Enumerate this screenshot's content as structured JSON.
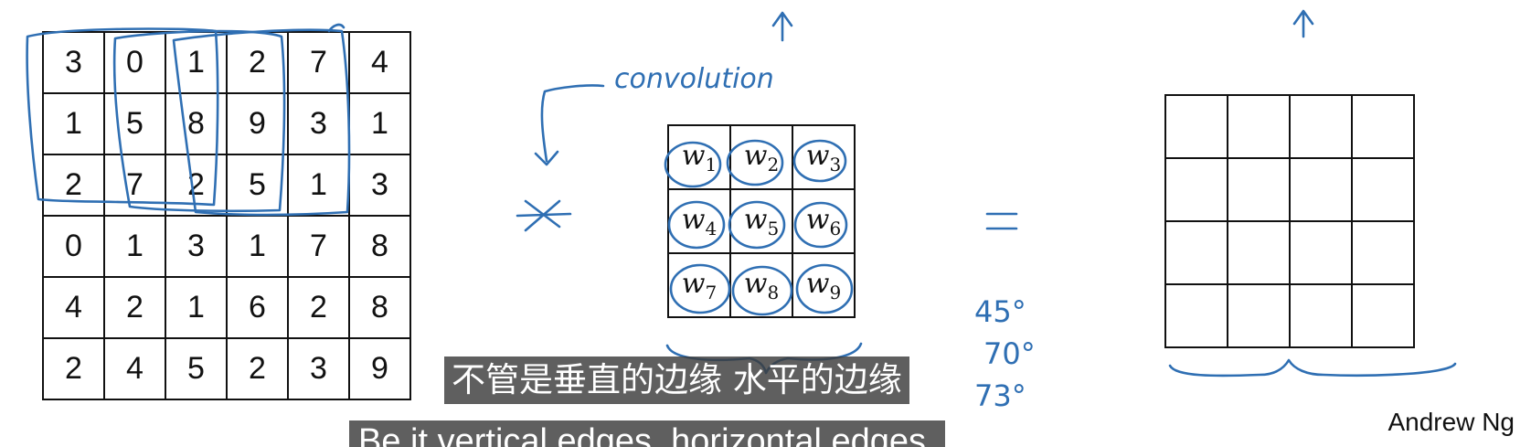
{
  "input_matrix": [
    [
      "3",
      "0",
      "1",
      "2",
      "7",
      "4"
    ],
    [
      "1",
      "5",
      "8",
      "9",
      "3",
      "1"
    ],
    [
      "2",
      "7",
      "2",
      "5",
      "1",
      "3"
    ],
    [
      "0",
      "1",
      "3",
      "1",
      "7",
      "8"
    ],
    [
      "4",
      "2",
      "1",
      "6",
      "2",
      "8"
    ],
    [
      "2",
      "4",
      "5",
      "2",
      "3",
      "9"
    ]
  ],
  "filter": [
    [
      {
        "w": "w",
        "sub": "1"
      },
      {
        "w": "w",
        "sub": "2"
      },
      {
        "w": "w",
        "sub": "3"
      }
    ],
    [
      {
        "w": "w",
        "sub": "4"
      },
      {
        "w": "w",
        "sub": "5"
      },
      {
        "w": "w",
        "sub": "6"
      }
    ],
    [
      {
        "w": "w",
        "sub": "7"
      },
      {
        "w": "w",
        "sub": "8"
      },
      {
        "w": "w",
        "sub": "9"
      }
    ]
  ],
  "annotations": {
    "convolution_label": "convolution",
    "operator": "*",
    "equals": "=",
    "angles": [
      "45°",
      "70°",
      "73°"
    ]
  },
  "author": "Andrew Ng",
  "subtitles": {
    "chinese": "不管是垂直的边缘 水平的边缘",
    "english": "Be it vertical edges, horizontal edges,"
  },
  "colors": {
    "ink": "#2f6fb3",
    "grid": "#111111",
    "subtitle_bg": "#3c3c3c"
  }
}
